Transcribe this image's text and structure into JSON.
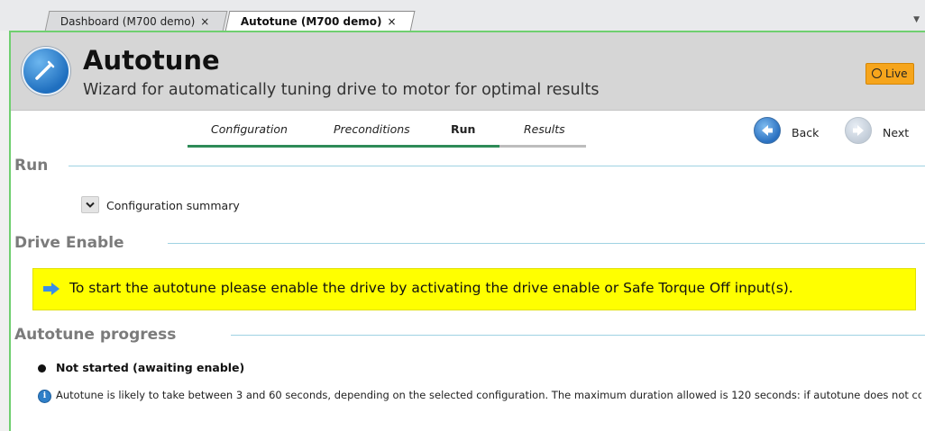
{
  "tabs": [
    {
      "label": "Dashboard (M700 demo)",
      "close": "×"
    },
    {
      "label": "Autotune (M700 demo)",
      "close": "×"
    }
  ],
  "header": {
    "title": "Autotune",
    "subtitle": "Wizard for automatically tuning drive to motor for optimal results",
    "live_label": "Live"
  },
  "steps": [
    {
      "label": "Configuration",
      "state": "done"
    },
    {
      "label": "Preconditions",
      "state": "done"
    },
    {
      "label": "Run",
      "state": "active"
    },
    {
      "label": "Results",
      "state": "pending"
    }
  ],
  "nav": {
    "back_label": "Back",
    "next_label": "Next"
  },
  "sections": {
    "run": {
      "title": "Run",
      "summary_label": "Configuration summary"
    },
    "drive_enable": {
      "title": "Drive Enable",
      "message": "To start the autotune please enable the drive by activating the drive enable or Safe Torque Off input(s)."
    },
    "progress": {
      "title": "Autotune progress",
      "status": "Not started (awaiting enable)",
      "info": "Autotune is likely to take between 3 and 60 seconds, depending on the selected configuration. The maximum duration allowed is 120 seconds: if autotune does not complete in this time it will be aborted."
    }
  },
  "colors": {
    "accent_green": "#6fcf6f",
    "step_done": "#2e8b57",
    "step_pending": "#bdbdbd",
    "live_badge": "#f6a51c",
    "banner": "#ffff00",
    "section_rule": "#9fd2e2"
  },
  "icons": [
    "wizard-icon",
    "back-arrow-icon",
    "next-arrow-icon",
    "chevron-down-icon",
    "arrow-right-icon",
    "info-icon",
    "bullet-icon",
    "live-dot-icon"
  ]
}
